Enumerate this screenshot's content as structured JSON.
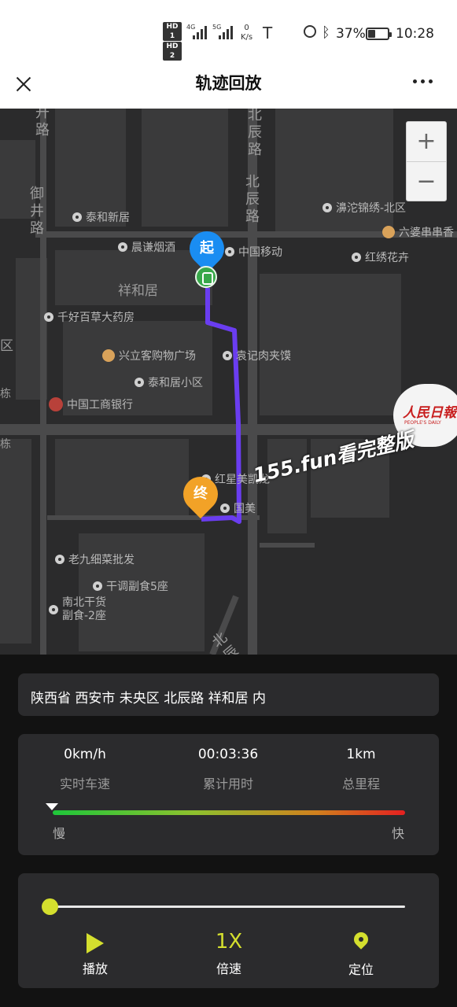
{
  "status_bar": {
    "hd1": "HD 1",
    "hd2": "HD 2",
    "net1": "4G",
    "net2": "5G",
    "net_speed_value": "0",
    "net_speed_unit": "K/s",
    "battery_pct": "37%",
    "battery_level": 0.37,
    "time": "10:28"
  },
  "header": {
    "title": "轨迹回放"
  },
  "map": {
    "zoom_in": "+",
    "zoom_out": "−",
    "start_marker": "起",
    "end_marker": "终",
    "watermark": "155.fun看完整版",
    "logo_text": "人民日報",
    "logo_sub": "PEOPLE'S DAILY",
    "area_labels": [
      "祥和居",
      "区",
      "栋",
      "栋"
    ],
    "road_labels": [
      "升路",
      "御井路",
      "北辰路",
      "北辰路",
      "北辰路"
    ],
    "pois": [
      "泰和新居",
      "晨谦烟酒",
      "中国移动",
      "濞沱锦绣-北区",
      "六婆串串香",
      "红绣花卉",
      "千好百草大药房",
      "兴立客购物广场",
      "袁记肉夹馍",
      "泰和居小区",
      "中国工商银行",
      "红星美凯龙",
      "国美",
      "老九细菜批发",
      "干调副食5座",
      "南北干货",
      "副食-2座"
    ]
  },
  "address": "陕西省 西安市 未央区 北辰路 祥和居 内",
  "stats": {
    "speed": {
      "value": "0km/h",
      "label": "实时车速"
    },
    "elapsed": {
      "value": "00:03:36",
      "label": "累计用时"
    },
    "distance": {
      "value": "1km",
      "label": "总里程"
    },
    "slow_label": "慢",
    "fast_label": "快"
  },
  "controls": {
    "progress": 0,
    "play_label": "播放",
    "speed_value": "1X",
    "speed_label": "倍速",
    "locate_label": "定位"
  },
  "colors": {
    "accent": "#d4df2e",
    "route": "#6a3df0",
    "start_marker": "#1a8df2",
    "end_marker": "#f2a227",
    "panel": "#2b2b2d"
  }
}
